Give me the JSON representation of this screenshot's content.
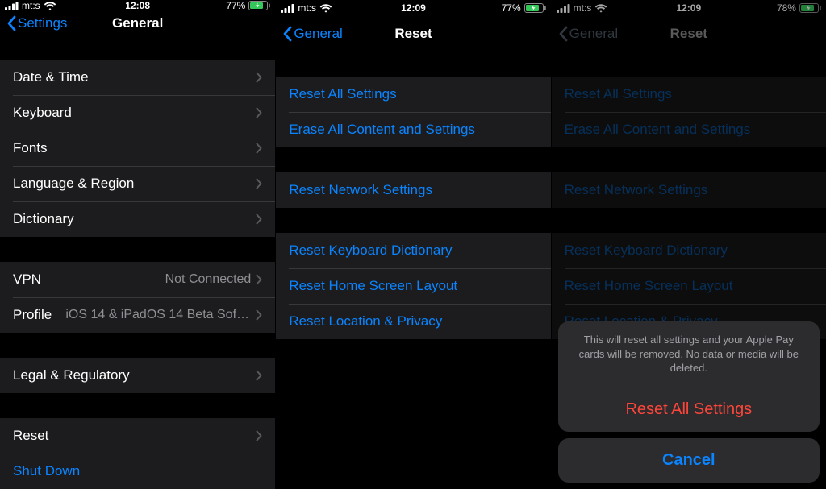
{
  "screens": [
    {
      "status": {
        "carrier": "mt:s",
        "time": "12:08",
        "battery_pct": "77%"
      },
      "nav": {
        "back": "Settings",
        "title": "General"
      },
      "groups": [
        {
          "gap": true,
          "cells": [
            {
              "key": "date-time",
              "label": "Date & Time",
              "disclosure": true
            },
            {
              "key": "keyboard",
              "label": "Keyboard",
              "disclosure": true
            },
            {
              "key": "fonts",
              "label": "Fonts",
              "disclosure": true
            },
            {
              "key": "language-region",
              "label": "Language & Region",
              "disclosure": true
            },
            {
              "key": "dictionary",
              "label": "Dictionary",
              "disclosure": true
            }
          ]
        },
        {
          "gap": true,
          "cells": [
            {
              "key": "vpn",
              "label": "VPN",
              "value": "Not Connected",
              "disclosure": true
            },
            {
              "key": "profile",
              "label": "Profile",
              "value": "iOS 14 & iPadOS 14 Beta Softwar...",
              "disclosure": true
            }
          ]
        },
        {
          "gap": true,
          "cells": [
            {
              "key": "legal",
              "label": "Legal & Regulatory",
              "disclosure": true
            }
          ]
        },
        {
          "gap": true,
          "cells": [
            {
              "key": "reset",
              "label": "Reset",
              "disclosure": true
            },
            {
              "key": "shut-down",
              "label": "Shut Down",
              "link": true
            }
          ]
        }
      ]
    },
    {
      "status": {
        "carrier": "mt:s",
        "time": "12:09",
        "battery_pct": "77%"
      },
      "nav": {
        "back": "General",
        "title": "Reset"
      },
      "groups": [
        {
          "gap": true,
          "cells": [
            {
              "key": "reset-all",
              "label": "Reset All Settings",
              "link": true
            },
            {
              "key": "erase-all",
              "label": "Erase All Content and Settings",
              "link": true
            }
          ]
        },
        {
          "gap": true,
          "cells": [
            {
              "key": "reset-network",
              "label": "Reset Network Settings",
              "link": true
            }
          ]
        },
        {
          "gap": true,
          "cells": [
            {
              "key": "reset-keyboard",
              "label": "Reset Keyboard Dictionary",
              "link": true
            },
            {
              "key": "reset-home",
              "label": "Reset Home Screen Layout",
              "link": true
            },
            {
              "key": "reset-location",
              "label": "Reset Location & Privacy",
              "link": true
            }
          ]
        }
      ]
    },
    {
      "status": {
        "carrier": "mt:s",
        "time": "12:09",
        "battery_pct": "78%"
      },
      "nav": {
        "back": "General",
        "title": "Reset"
      },
      "dimmed": true,
      "groups": [
        {
          "gap": true,
          "cells": [
            {
              "key": "reset-all",
              "label": "Reset All Settings",
              "link": true
            },
            {
              "key": "erase-all",
              "label": "Erase All Content and Settings",
              "link": true
            }
          ]
        },
        {
          "gap": true,
          "cells": [
            {
              "key": "reset-network",
              "label": "Reset Network Settings",
              "link": true
            }
          ]
        },
        {
          "gap": true,
          "cells": [
            {
              "key": "reset-keyboard",
              "label": "Reset Keyboard Dictionary",
              "link": true
            },
            {
              "key": "reset-home",
              "label": "Reset Home Screen Layout",
              "link": true
            },
            {
              "key": "reset-location",
              "label": "Reset Location & Privacy",
              "link": true
            }
          ]
        }
      ],
      "actionsheet": {
        "message": "This will reset all settings and your Apple Pay cards will be removed. No data or media will be deleted.",
        "destructive": "Reset All Settings",
        "cancel": "Cancel"
      }
    }
  ]
}
